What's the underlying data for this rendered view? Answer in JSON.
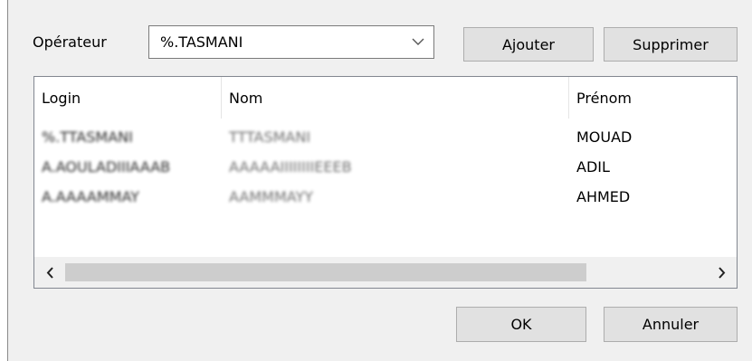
{
  "operator": {
    "label": "Opérateur",
    "selected_value": "%.TASMANI"
  },
  "buttons": {
    "add_label": "Ajouter",
    "remove_label": "Supprimer",
    "ok_label": "OK",
    "cancel_label": "Annuler"
  },
  "list": {
    "columns": [
      "Login",
      "Nom",
      "Prénom"
    ],
    "rows": [
      {
        "login": "%.TTASMANI",
        "nom": "TTTASMANI",
        "prenom": "MOUAD"
      },
      {
        "login": "A.AOULADIIIAAAB",
        "nom": "AAAAAIIIIIIIIEEEB",
        "prenom": "ADIL"
      },
      {
        "login": "A.AAAAMMAY",
        "nom": "AAMMMAYY",
        "prenom": "AHMED"
      }
    ]
  },
  "icons": {
    "combo_arrow": "chevron-down-icon",
    "scroll_left": "chevron-left-icon",
    "scroll_right": "chevron-right-icon"
  },
  "colors": {
    "dialog_bg": "#f0f0f0",
    "button_bg": "#e1e1e1",
    "scroll_thumb": "#cdcdcd"
  }
}
